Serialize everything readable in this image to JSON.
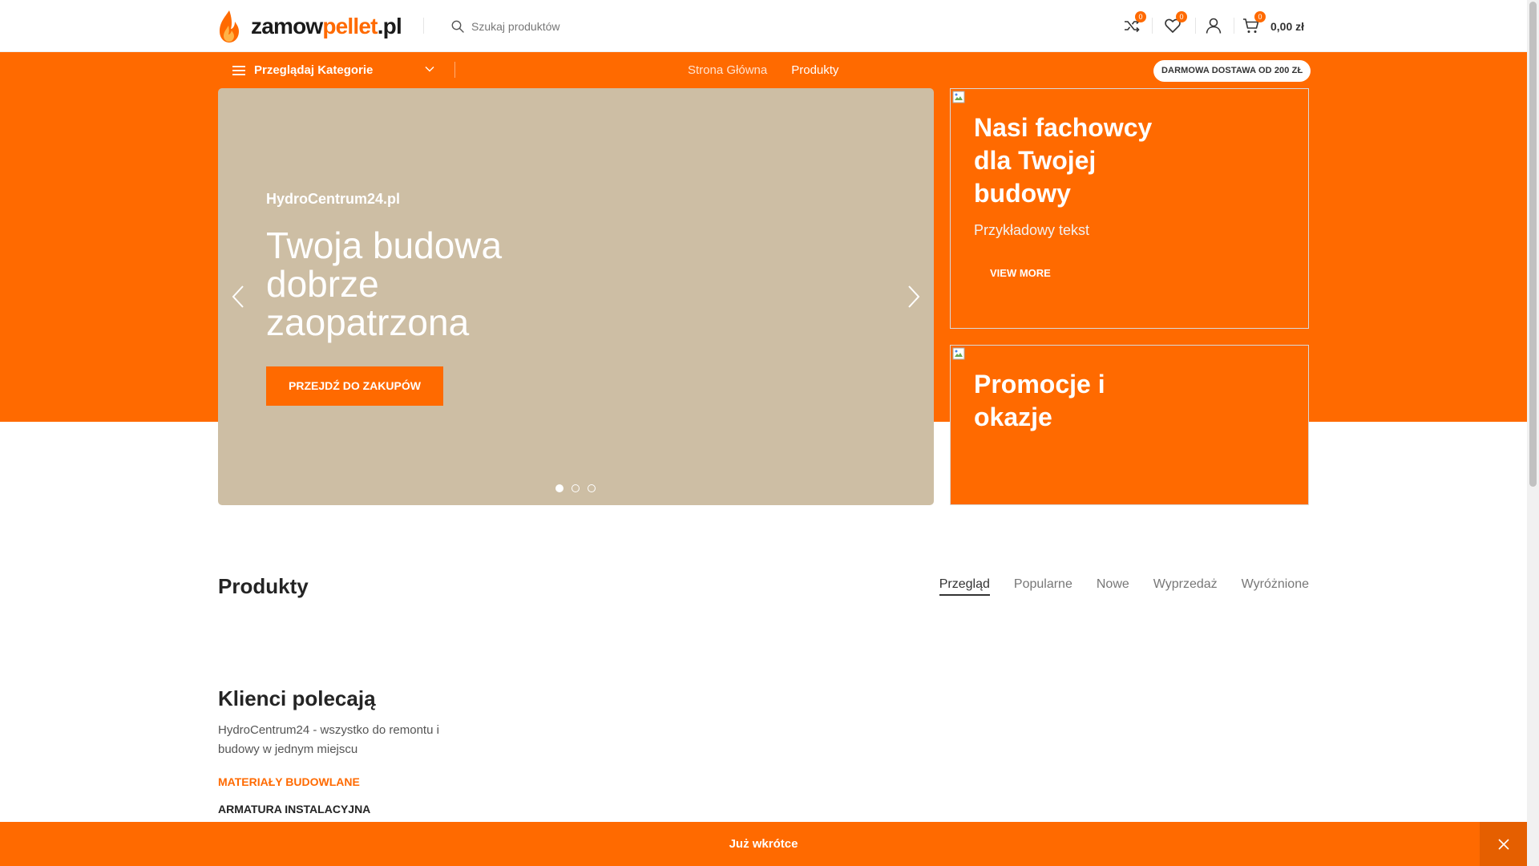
{
  "header": {
    "logo": {
      "part1": "zamow",
      "part2": "pellet",
      "part3": ".pl"
    },
    "search": {
      "placeholder": "Szukaj produktów"
    },
    "compare_count": "0",
    "wishlist_count": "0",
    "cart_count": "0",
    "cart_total": "0,00 zł"
  },
  "nav": {
    "categories_label": "Przeglądaj Kategorie",
    "links": [
      "Strona Główna",
      "Produkty"
    ],
    "promo_pill": "DARMOWA DOSTAWA OD 200 ZŁ"
  },
  "slider": {
    "subtitle": "HydroCentrum24.pl",
    "title": "Twoja budowa dobrze zaopatrzona",
    "button": "PRZEJDŹ DO ZAKUPÓW",
    "dots": 3,
    "active_dot": 1
  },
  "banners": [
    {
      "title": "Nasi fachowcy dla Twojej budowy",
      "text": "Przykładowy tekst",
      "button": "VIEW MORE"
    },
    {
      "title": "Promocje i okazje"
    }
  ],
  "products": {
    "title": "Produkty",
    "tabs": [
      "Przegląd",
      "Popularne",
      "Nowe",
      "Wyprzedaż",
      "Wyróżnione"
    ],
    "active_tab": 0
  },
  "clients": {
    "title": "Klienci polecają",
    "text": "HydroCentrum24 - wszystko do remontu i budowy w jednym miejscu",
    "categories": [
      "MATERIAŁY BUDOWLANE",
      "ARMATURA INSTALACYJNA"
    ]
  },
  "notice": {
    "text": "Już wkrótce"
  },
  "colors": {
    "accent": "#ff6a00",
    "slider_bg": "#cdbea4"
  }
}
